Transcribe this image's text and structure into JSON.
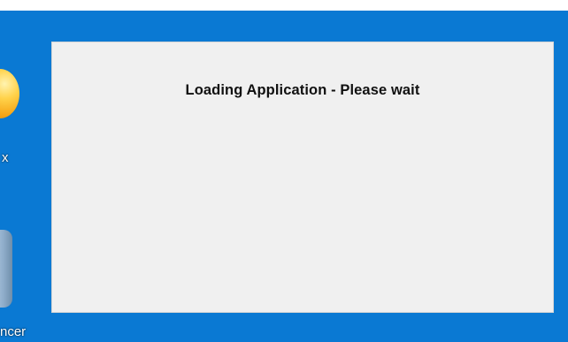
{
  "desktop": {
    "icons": [
      {
        "label": "x",
        "icon": "app-orb-icon"
      },
      {
        "label": "ncer",
        "icon": "app-window-icon"
      }
    ]
  },
  "splash": {
    "message": "Loading Application - Please wait"
  },
  "colors": {
    "desktop_background": "#0a79d3",
    "splash_background": "#f0f0f0",
    "text": "#111111"
  }
}
